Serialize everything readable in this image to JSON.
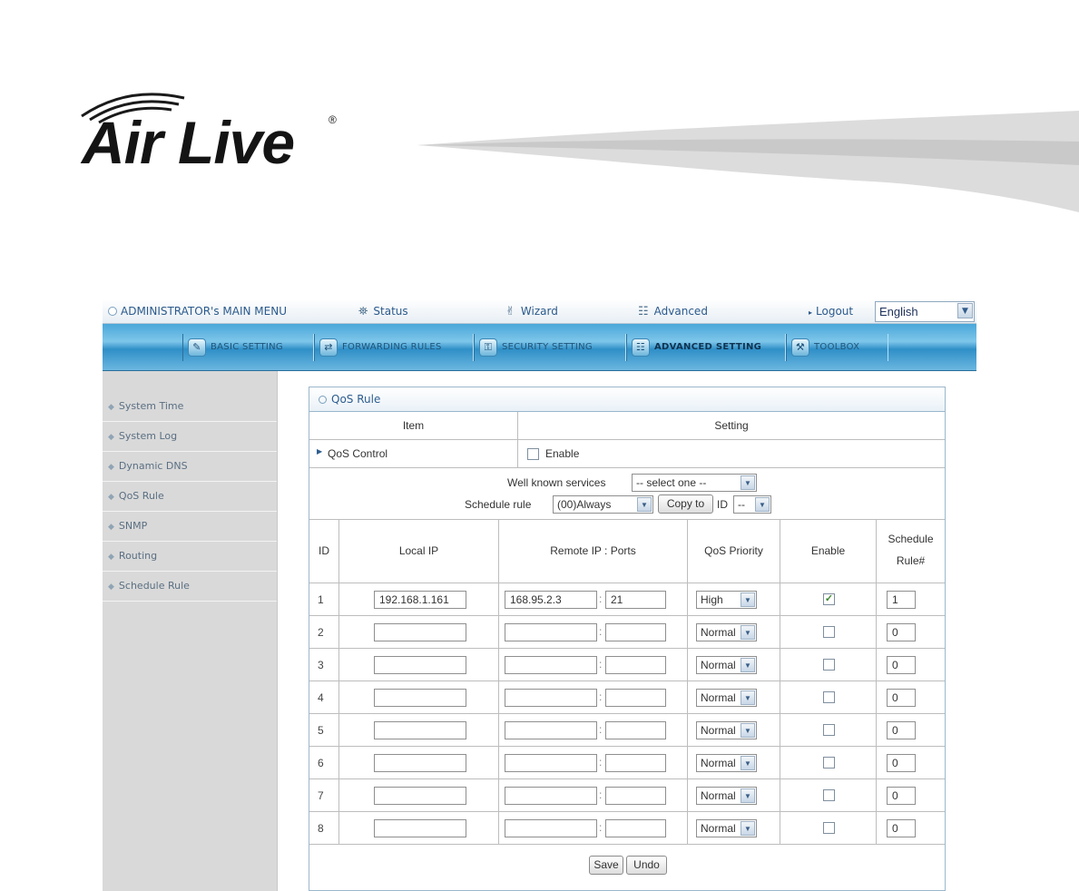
{
  "logo": {
    "text": "Air Live",
    "registered": "®"
  },
  "topbar": {
    "admin_menu": "ADMINISTRATOR's MAIN MENU",
    "status": "Status",
    "wizard": "Wizard",
    "advanced": "Advanced",
    "logout": "Logout",
    "language": "English"
  },
  "nav": {
    "tabs": [
      {
        "label": "BASIC SETTING",
        "icon": "basic-setting-icon"
      },
      {
        "label": "FORWARDING RULES",
        "icon": "forwarding-rules-icon"
      },
      {
        "label": "SECURITY SETTING",
        "icon": "security-setting-icon"
      },
      {
        "label": "ADVANCED SETTING",
        "icon": "advanced-setting-icon"
      },
      {
        "label": "TOOLBOX",
        "icon": "toolbox-icon"
      }
    ],
    "active": "ADVANCED SETTING"
  },
  "sidebar": {
    "items": [
      {
        "label": "System Time"
      },
      {
        "label": "System Log"
      },
      {
        "label": "Dynamic DNS"
      },
      {
        "label": "QoS Rule"
      },
      {
        "label": "SNMP"
      },
      {
        "label": "Routing"
      },
      {
        "label": "Schedule Rule"
      }
    ]
  },
  "panel": {
    "title": "QoS Rule",
    "header_item": "Item",
    "header_setting": "Setting",
    "qos_control_label": "QoS Control",
    "qos_control_enable_label": "Enable",
    "qos_control_enabled": false,
    "well_known_label": "Well known services",
    "well_known_value": "-- select one --",
    "schedule_rule_label": "Schedule rule",
    "schedule_rule_value": "(00)Always",
    "copy_to_button": "Copy to",
    "id_label": "ID",
    "id_value": "--",
    "columns": {
      "id": "ID",
      "local_ip": "Local IP",
      "remote": "Remote IP : Ports",
      "priority": "QoS Priority",
      "enable": "Enable",
      "schedule_line1": "Schedule",
      "schedule_line2": "Rule#"
    },
    "rows": [
      {
        "id": "1",
        "local_ip": "192.168.1.161",
        "remote_ip": "168.95.2.3",
        "port": "21",
        "priority": "High",
        "enabled": true,
        "schedule": "1"
      },
      {
        "id": "2",
        "local_ip": "",
        "remote_ip": "",
        "port": "",
        "priority": "Normal",
        "enabled": false,
        "schedule": "0"
      },
      {
        "id": "3",
        "local_ip": "",
        "remote_ip": "",
        "port": "",
        "priority": "Normal",
        "enabled": false,
        "schedule": "0"
      },
      {
        "id": "4",
        "local_ip": "",
        "remote_ip": "",
        "port": "",
        "priority": "Normal",
        "enabled": false,
        "schedule": "0"
      },
      {
        "id": "5",
        "local_ip": "",
        "remote_ip": "",
        "port": "",
        "priority": "Normal",
        "enabled": false,
        "schedule": "0"
      },
      {
        "id": "6",
        "local_ip": "",
        "remote_ip": "",
        "port": "",
        "priority": "Normal",
        "enabled": false,
        "schedule": "0"
      },
      {
        "id": "7",
        "local_ip": "",
        "remote_ip": "",
        "port": "",
        "priority": "Normal",
        "enabled": false,
        "schedule": "0"
      },
      {
        "id": "8",
        "local_ip": "",
        "remote_ip": "",
        "port": "",
        "priority": "Normal",
        "enabled": false,
        "schedule": "0"
      }
    ],
    "save_button": "Save",
    "undo_button": "Undo"
  }
}
